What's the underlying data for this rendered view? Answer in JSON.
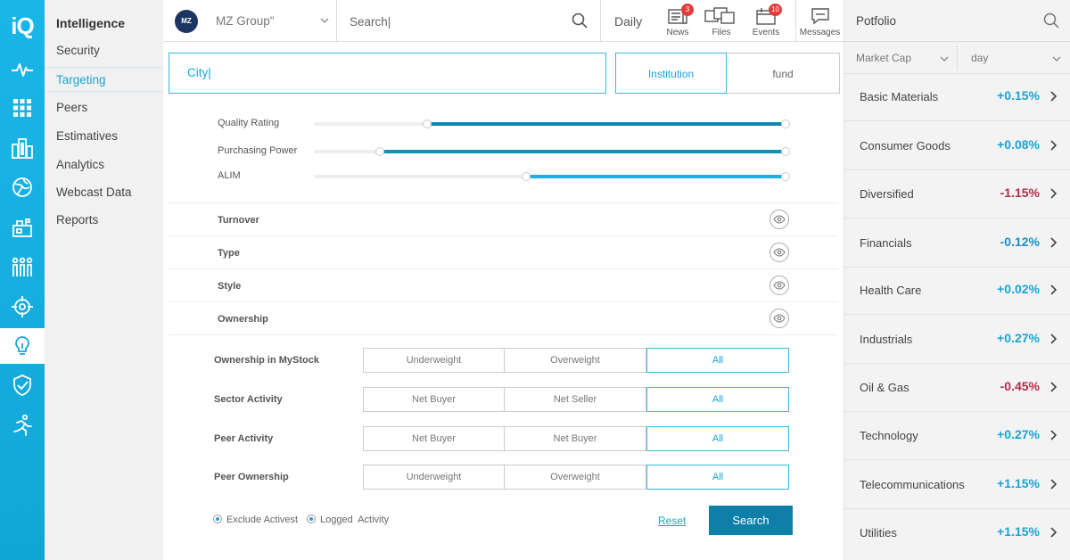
{
  "app": {
    "logo": "iQ"
  },
  "rail": {
    "icons": [
      "pulse-icon",
      "grid-icon",
      "buildings-icon",
      "globe-icon",
      "mailbox-icon",
      "people-icon",
      "target-icon",
      "lightbulb-icon",
      "shield-check-icon",
      "runner-icon"
    ],
    "active": "lightbulb-icon"
  },
  "subnav": {
    "header": "Intelligence",
    "items": [
      {
        "label": "Security"
      },
      {
        "label": "Targeting",
        "active": true
      },
      {
        "label": "Peers"
      },
      {
        "label": "Estimatives"
      },
      {
        "label": "Analytics"
      },
      {
        "label": "Webcast Data"
      },
      {
        "label": "Reports"
      }
    ]
  },
  "topbar": {
    "company_badge": "MZ",
    "company_name": "MZ Group\"",
    "search_placeholder": "Search|",
    "daily": "Daily",
    "news": {
      "label": "News",
      "count": "3"
    },
    "files": {
      "label": "Files"
    },
    "events": {
      "label": "Events",
      "count": "10"
    },
    "messages": {
      "label": "Messages"
    }
  },
  "targeting": {
    "city_value": "City|",
    "institution": "Institution",
    "fund": "fund",
    "sliders": [
      {
        "label": "Quality Rating",
        "from": 0.24,
        "to": 1.0,
        "color": "#0e88b3"
      },
      {
        "label": "Purchasing Power",
        "from": 0.14,
        "to": 1.0,
        "color": "#138fba"
      },
      {
        "label": "ALIM",
        "from": 0.45,
        "to": 1.0,
        "color": "#1ab0e0"
      }
    ],
    "filters": [
      {
        "label": "Turnover"
      },
      {
        "label": "Type"
      },
      {
        "label": "Style"
      },
      {
        "label": "Ownership"
      }
    ],
    "segments": [
      {
        "label": "Ownership in MyStock",
        "options": [
          "Underweight",
          "Overweight",
          "All"
        ]
      },
      {
        "label": "Sector Activity",
        "options": [
          "Net Buyer",
          "Net Seller",
          "All"
        ]
      },
      {
        "label": "Peer Activity",
        "options": [
          "Net Buyer",
          "Net Buyer",
          "All"
        ]
      },
      {
        "label": "Peer Ownership",
        "options": [
          "Underweight",
          "Overweight",
          "All"
        ]
      }
    ],
    "exclude_activest": "Exclude Activest",
    "logged_activity": "Logged  Activity",
    "reset": "Reset",
    "search": "Search"
  },
  "portfolio": {
    "title": "Potfolio",
    "filter_metric": "Market Cap",
    "filter_period": "day",
    "sectors": [
      {
        "name": "Basic Materials",
        "value": "+0.15%",
        "color": "#1aa4d6"
      },
      {
        "name": "Consumer Goods",
        "value": "+0.08%",
        "color": "#1aa4d6"
      },
      {
        "name": "Diversified",
        "value": "-1.15%",
        "color": "#b32d4a"
      },
      {
        "name": "Financials",
        "value": "-0.12%",
        "color": "#1a8fc2"
      },
      {
        "name": "Health Care",
        "value": "+0.02%",
        "color": "#1aa4d6"
      },
      {
        "name": "Industrials",
        "value": "+0.27%",
        "color": "#1aa4d6"
      },
      {
        "name": "Oil & Gas",
        "value": "-0.45%",
        "color": "#b32d4a"
      },
      {
        "name": "Technology",
        "value": "+0.27%",
        "color": "#1aa4d6"
      },
      {
        "name": "Telecommunications",
        "value": "+1.15%",
        "color": "#1aa4d6"
      },
      {
        "name": "Utilities",
        "value": "+1.15%",
        "color": "#1aa4d6"
      }
    ]
  }
}
